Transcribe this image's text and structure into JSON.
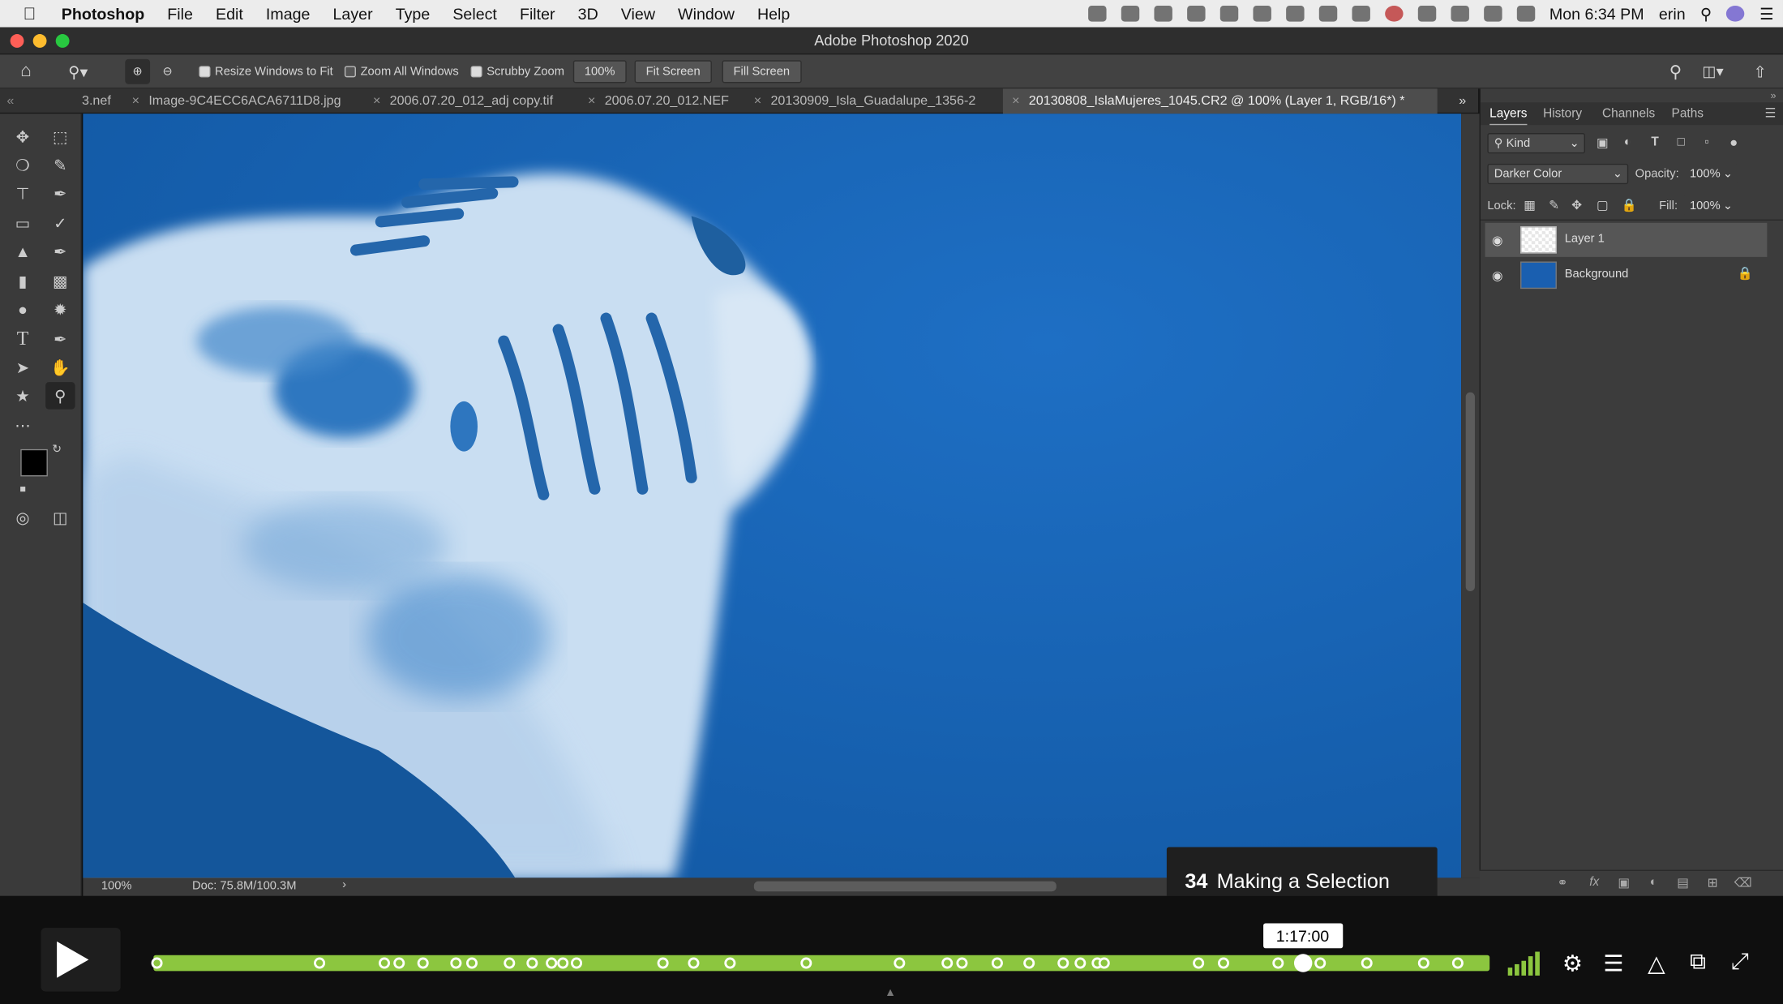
{
  "menubar": {
    "app": "Photoshop",
    "items": [
      "File",
      "Edit",
      "Image",
      "Layer",
      "Type",
      "Select",
      "Filter",
      "3D",
      "View",
      "Window",
      "Help"
    ],
    "clock": "Mon 6:34 PM",
    "user": "erin"
  },
  "window": {
    "title": "Adobe Photoshop 2020"
  },
  "options": {
    "resize_windows": "Resize Windows to Fit",
    "zoom_all": "Zoom All Windows",
    "scrubby_zoom": "Scrubby Zoom",
    "zoom_value": "100%",
    "fit_screen": "Fit Screen",
    "fill_screen": "Fill Screen"
  },
  "tabs": [
    {
      "label": "3.nef"
    },
    {
      "label": "Image-9C4ECC6ACA6711D8.jpg"
    },
    {
      "label": "2006.07.20_012_adj copy.tif"
    },
    {
      "label": "2006.07.20_012.NEF"
    },
    {
      "label": "20130909_Isla_Guadalupe_1356-2"
    },
    {
      "label": "20130808_IslaMujeres_1045.CR2 @ 100% (Layer 1, RGB/16*) *"
    }
  ],
  "status": {
    "zoom": "100%",
    "doc": "Doc: 75.8M/100.3M"
  },
  "panel": {
    "tabs": [
      "Layers",
      "History",
      "Channels",
      "Paths"
    ],
    "kind": "Kind",
    "blend_mode": "Darker Color",
    "opacity_label": "Opacity:",
    "opacity": "100%",
    "lock_label": "Lock:",
    "fill_label": "Fill:",
    "fill": "100%",
    "layers": [
      {
        "name": "Layer 1"
      },
      {
        "name": "Background"
      }
    ]
  },
  "video": {
    "lesson_number": "34",
    "lesson_title": "Making a Selection",
    "time": "1:17:00",
    "progress": 0.86
  },
  "colors": {
    "accent": "#8cc63f",
    "canvas_blue": "#1b63b2",
    "panel": "#3c3c3c"
  }
}
